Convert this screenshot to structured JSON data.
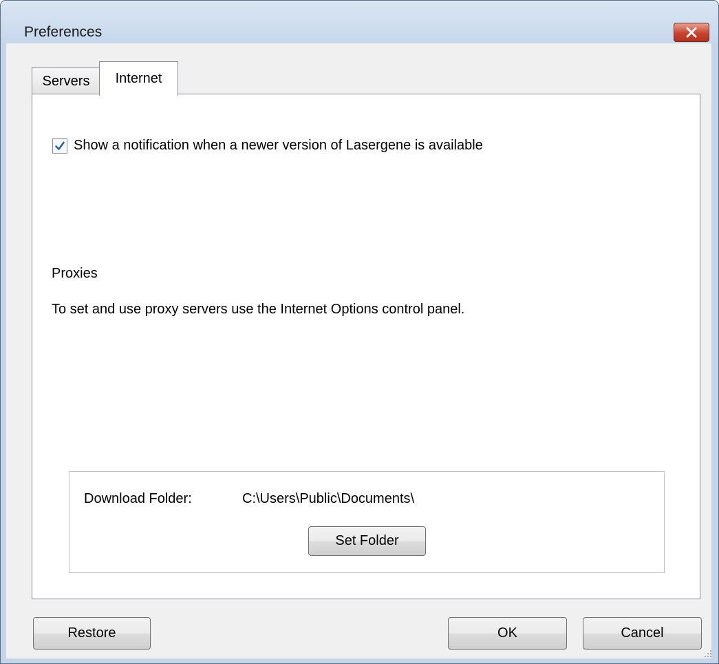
{
  "window": {
    "title": "Preferences"
  },
  "tabs": [
    {
      "label": "Servers",
      "active": false
    },
    {
      "label": "Internet",
      "active": true
    }
  ],
  "internet": {
    "notify_checkbox": {
      "label": "Show a notification when a newer version of Lasergene is available",
      "checked": true
    },
    "proxies_heading": "Proxies",
    "proxies_text": "To set and use proxy servers use the Internet Options control panel.",
    "download": {
      "label": "Download Folder:",
      "path": "C:\\Users\\Public\\Documents\\",
      "set_folder_label": "Set Folder"
    }
  },
  "footer": {
    "restore_label": "Restore",
    "ok_label": "OK",
    "cancel_label": "Cancel"
  },
  "colors": {
    "titlebar": "#c6d7eb",
    "close_button": "#c8432d",
    "checkmark": "#2c5fa8"
  }
}
